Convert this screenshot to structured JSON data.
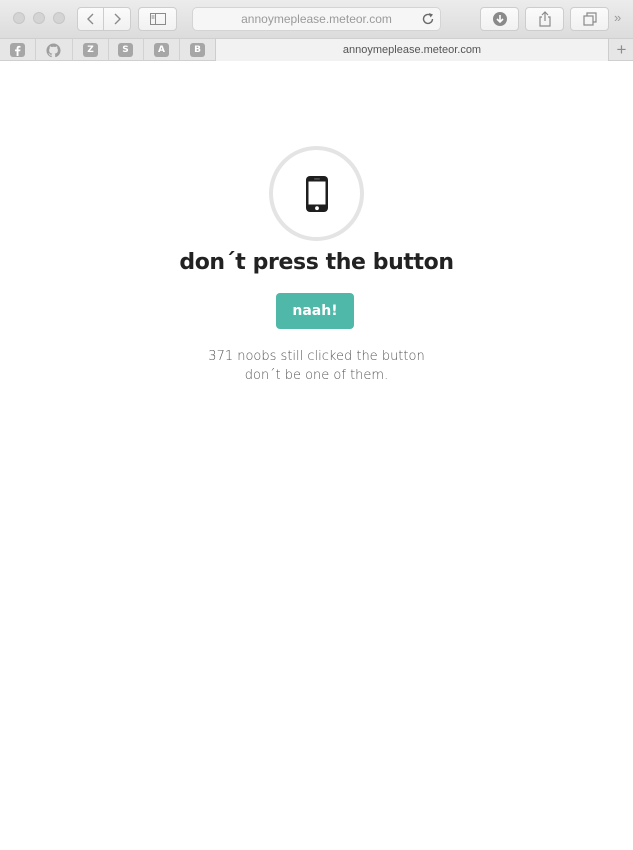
{
  "browser": {
    "address": "annoymeplease.meteor.com",
    "tab_title": "annoymeplease.meteor.com",
    "bookmarks": [
      "facebook-icon",
      "github-icon",
      "Z",
      "S",
      "A",
      "B"
    ],
    "new_tab_symbol": "+",
    "overflow_symbol": "»"
  },
  "page": {
    "icon": "smartphone-icon",
    "headline": "don´t press the button",
    "button_label": "naah!",
    "counter_line": "371 noobs still clicked the button",
    "tagline": "don´t be one of them."
  },
  "colors": {
    "button": "#4fb8a8",
    "headline": "#222222",
    "icon_ring": "#e4e4e4"
  }
}
